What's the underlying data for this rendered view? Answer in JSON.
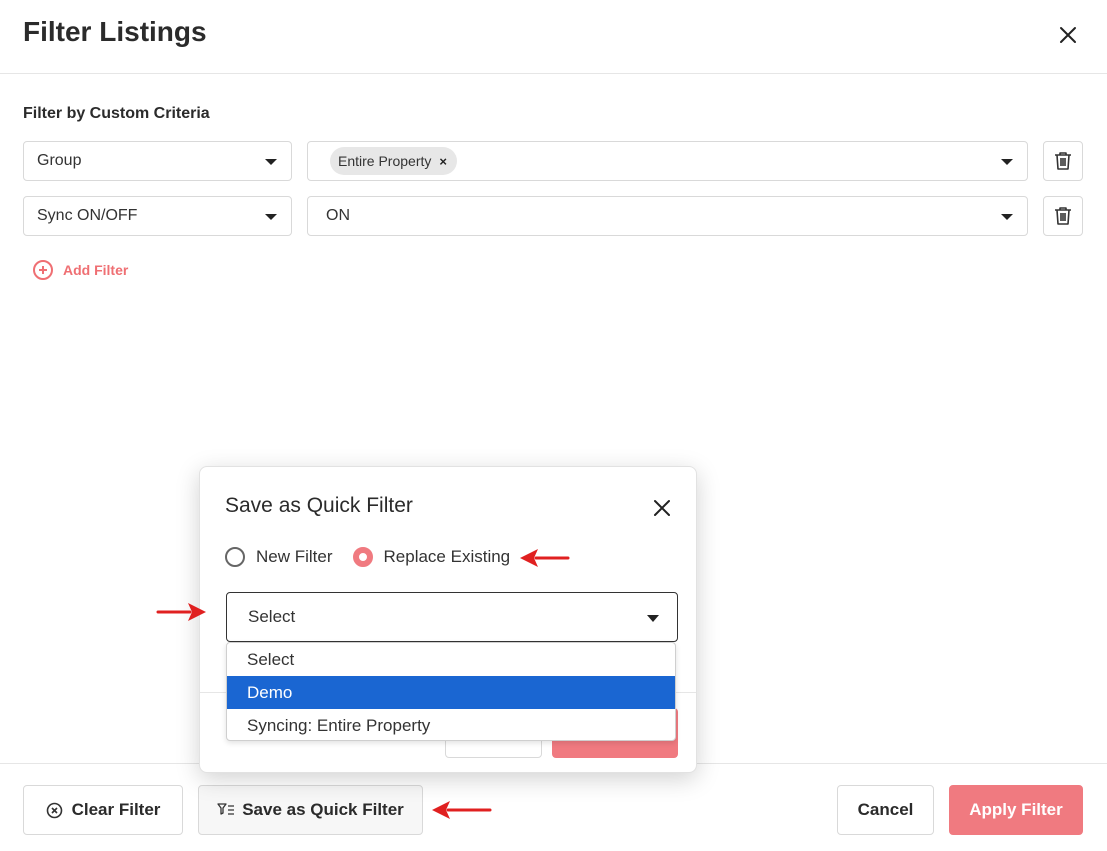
{
  "header": {
    "title": "Filter Listings"
  },
  "filters": {
    "section_label": "Filter by Custom Criteria",
    "rows": [
      {
        "field": "Group",
        "value_chip": "Entire Property",
        "chip_remove": "×"
      },
      {
        "field": "Sync ON/OFF",
        "value": "ON"
      }
    ],
    "add_filter_label": "Add Filter"
  },
  "footer": {
    "clear_label": "Clear Filter",
    "quick_label": "Save as Quick Filter",
    "cancel_label": "Cancel",
    "apply_label": "Apply Filter"
  },
  "modal": {
    "title": "Save as Quick Filter",
    "radio_new": "New Filter",
    "radio_replace": "Replace Existing",
    "selected_radio": "Replace Existing",
    "select_value": "Select",
    "options": [
      "Select",
      "Demo",
      "Syncing: Entire Property"
    ],
    "highlighted_option": "Demo"
  },
  "colors": {
    "accent": "#f07a80",
    "highlight": "#1a66d2",
    "annotation_arrow": "#e02020"
  }
}
